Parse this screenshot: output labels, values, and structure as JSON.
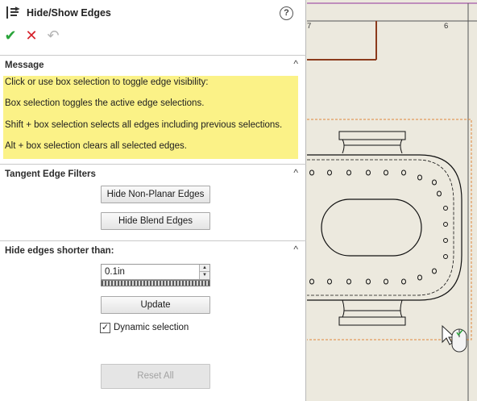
{
  "panel": {
    "title": "Hide/Show Edges",
    "help": "?",
    "actions": {
      "ok": "✔",
      "cancel": "✕",
      "undo": "↶"
    }
  },
  "message_section": {
    "header": "Message",
    "lines": [
      "Click or use box selection to toggle edge visibility:",
      "Box selection toggles the active edge selections.",
      "Shift + box selection selects all edges including previous selections.",
      "Alt + box selection clears all selected edges."
    ]
  },
  "tangent_section": {
    "header": "Tangent Edge Filters",
    "hide_non_planar": "Hide Non-Planar Edges",
    "hide_blend": "Hide Blend Edges"
  },
  "short_edges_section": {
    "header": "Hide edges shorter than:",
    "value": "0.1in",
    "update": "Update",
    "dynamic_selection_label": "Dynamic selection",
    "dynamic_selection_checked": true,
    "reset_all": "Reset All"
  },
  "chevron": "^",
  "drawing": {
    "zone_labels": [
      "7",
      "6"
    ],
    "colors": {
      "border_line": "#8b3a1c",
      "selection_box": "#e0883a",
      "sheet": "#ece9de"
    }
  }
}
